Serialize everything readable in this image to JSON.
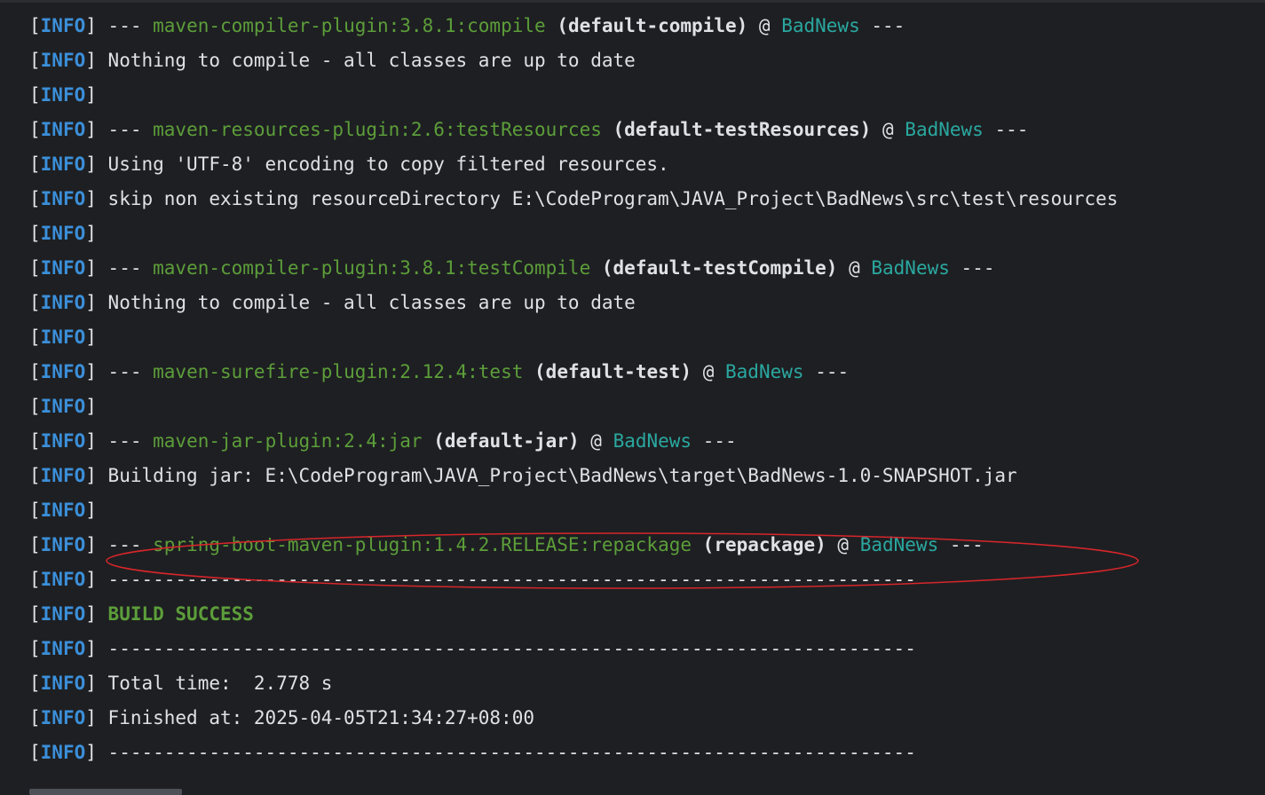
{
  "level": "INFO",
  "brackets": {
    "left": "[",
    "right": "]"
  },
  "lines": [
    {
      "type": "blank"
    },
    {
      "type": "plugin",
      "dashes": "---",
      "plugin": "maven-compiler-plugin:3.8.1:compile",
      "goal": "(default-compile)",
      "at": "@",
      "project": "BadNews",
      "tail": "---"
    },
    {
      "type": "text",
      "text": "Nothing to compile - all classes are up to date"
    },
    {
      "type": "blank"
    },
    {
      "type": "plugin",
      "dashes": "---",
      "plugin": "maven-resources-plugin:2.6:testResources",
      "goal": "(default-testResources)",
      "at": "@",
      "project": "BadNews",
      "tail": "---"
    },
    {
      "type": "text",
      "text": "Using 'UTF-8' encoding to copy filtered resources."
    },
    {
      "type": "text",
      "text": "skip non existing resourceDirectory E:\\CodeProgram\\JAVA_Project\\BadNews\\src\\test\\resources"
    },
    {
      "type": "blank"
    },
    {
      "type": "plugin",
      "dashes": "---",
      "plugin": "maven-compiler-plugin:3.8.1:testCompile",
      "goal": "(default-testCompile)",
      "at": "@",
      "project": "BadNews",
      "tail": "---"
    },
    {
      "type": "text",
      "text": "Nothing to compile - all classes are up to date"
    },
    {
      "type": "blank"
    },
    {
      "type": "plugin",
      "dashes": "---",
      "plugin": "maven-surefire-plugin:2.12.4:test",
      "goal": "(default-test)",
      "at": "@",
      "project": "BadNews",
      "tail": "---"
    },
    {
      "type": "blank"
    },
    {
      "type": "plugin",
      "dashes": "---",
      "plugin": "maven-jar-plugin:2.4:jar",
      "goal": "(default-jar)",
      "at": "@",
      "project": "BadNews",
      "tail": "---"
    },
    {
      "type": "text",
      "text": "Building jar: E:\\CodeProgram\\JAVA_Project\\BadNews\\target\\BadNews-1.0-SNAPSHOT.jar"
    },
    {
      "type": "blank"
    },
    {
      "type": "plugin",
      "highlighted": true,
      "dashes": "---",
      "plugin": "spring-boot-maven-plugin:1.4.2.RELEASE:repackage",
      "goal": "(repackage)",
      "at": "@",
      "project": "BadNews",
      "tail": "---"
    },
    {
      "type": "text",
      "text": "------------------------------------------------------------------------"
    },
    {
      "type": "success",
      "text": "BUILD SUCCESS"
    },
    {
      "type": "text",
      "text": "------------------------------------------------------------------------"
    },
    {
      "type": "text",
      "text": "Total time:  2.778 s"
    },
    {
      "type": "text",
      "text": "Finished at: 2025-04-05T21:34:27+08:00"
    },
    {
      "type": "text",
      "text": "------------------------------------------------------------------------"
    }
  ],
  "colors": {
    "background": "#1e1f22",
    "level": "#3b8fd9",
    "plugin": "#5c9e3a",
    "project": "#2aa8a0",
    "text": "#dfe1e5",
    "annotation": "#d7262b"
  }
}
